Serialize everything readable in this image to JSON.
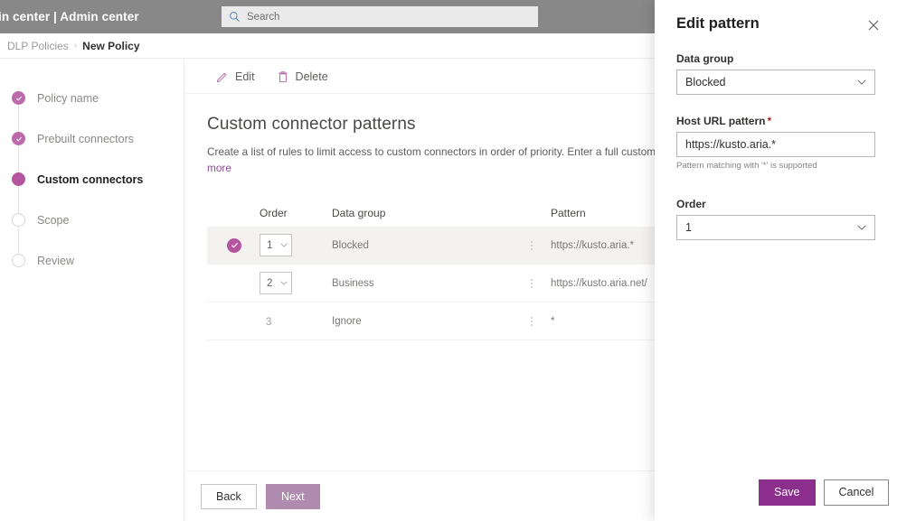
{
  "suite": {
    "brand": "in center  |  Admin center",
    "search_placeholder": "Search",
    "search_icon": "search-icon"
  },
  "breadcrumb": {
    "parent": "DLP Policies",
    "separator": "›",
    "current": "New Policy"
  },
  "wizard": {
    "steps": [
      {
        "label": "Policy name",
        "state": "done"
      },
      {
        "label": "Prebuilt connectors",
        "state": "done"
      },
      {
        "label": "Custom connectors",
        "state": "current"
      },
      {
        "label": "Scope",
        "state": "todo"
      },
      {
        "label": "Review",
        "state": "todo"
      }
    ]
  },
  "commandbar": {
    "edit_label": "Edit",
    "edit_icon": "pencil-icon",
    "delete_label": "Delete",
    "delete_icon": "trash-icon"
  },
  "content": {
    "title": "Custom connector patterns",
    "description": "Create a list of rules to limit access to custom connectors in order of priority. Enter a full custom connector U",
    "description_link": "more"
  },
  "table": {
    "headers": {
      "order": "Order",
      "data_group": "Data group",
      "pattern": "Pattern"
    },
    "rows": [
      {
        "selected": true,
        "order": "1",
        "order_editable": true,
        "data_group": "Blocked",
        "pattern": "https://kusto.aria.*"
      },
      {
        "selected": false,
        "order": "2",
        "order_editable": true,
        "data_group": "Business",
        "pattern": "https://kusto.aria.net/"
      },
      {
        "selected": false,
        "order": "3",
        "order_editable": false,
        "data_group": "Ignore",
        "pattern": "*"
      }
    ]
  },
  "footer": {
    "back_label": "Back",
    "next_label": "Next"
  },
  "panel": {
    "title": "Edit pattern",
    "close_icon": "close-icon",
    "data_group": {
      "label": "Data group",
      "value": "Blocked"
    },
    "host_url": {
      "label": "Host URL pattern",
      "required_mark": "*",
      "value": "https://kusto.aria.*",
      "hint": "Pattern matching with '*' is supported"
    },
    "order": {
      "label": "Order",
      "value": "1"
    },
    "save_label": "Save",
    "cancel_label": "Cancel"
  },
  "colors": {
    "accent": "#8c2f8c",
    "accent_light": "#b5559f",
    "accent_dim": "#b08bb0",
    "suitebar": "#888888",
    "required": "#a4262c"
  }
}
